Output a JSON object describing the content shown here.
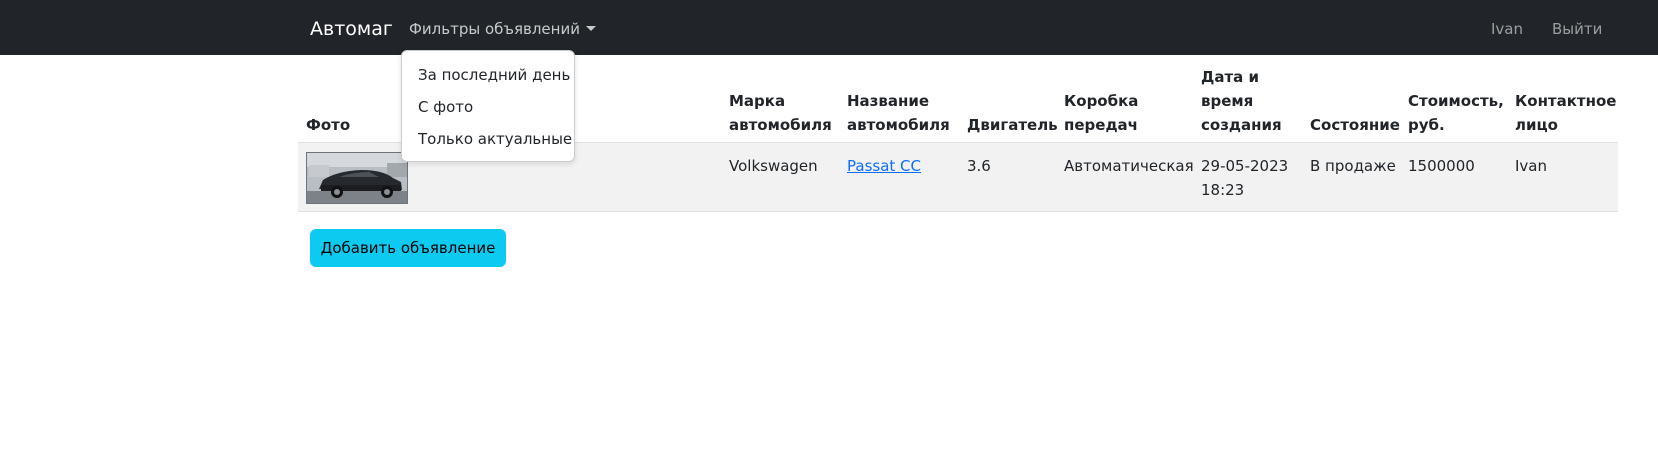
{
  "navbar": {
    "brand": "Автомаг",
    "filters_label": "Фильтры объявлений",
    "user": "Ivan",
    "logout": "Выйти"
  },
  "dropdown": {
    "items": [
      "За последний день",
      "С фото",
      "Только актуальные"
    ]
  },
  "table": {
    "headers": {
      "photo": "Фото",
      "brand": [
        "Марка",
        "автомобиля"
      ],
      "name": [
        "Название",
        "автомобиля"
      ],
      "engine": "Двигатель",
      "gearbox": [
        "Коробка",
        "передач"
      ],
      "created": [
        "Дата и",
        "время",
        "создания"
      ],
      "status": "Состояние",
      "price": [
        "Стоимость,",
        "руб."
      ],
      "contact": [
        "Контактное",
        "лицо"
      ]
    },
    "rows": [
      {
        "brand": "Volkswagen",
        "name": "Passat CC",
        "engine": "3.6",
        "gearbox": "Автоматическая",
        "date": "29-05-2023",
        "time": "18:23",
        "status": "В продаже",
        "price": "1500000",
        "contact": "Ivan"
      }
    ]
  },
  "add_button": "Добавить объявление",
  "colors": {
    "navbar_bg": "#212529",
    "button_bg": "#0dcaf0",
    "link": "#0d6efd",
    "row_bg": "#f2f2f2"
  },
  "icons": {
    "dropdown_caret": "caret-down-icon"
  }
}
